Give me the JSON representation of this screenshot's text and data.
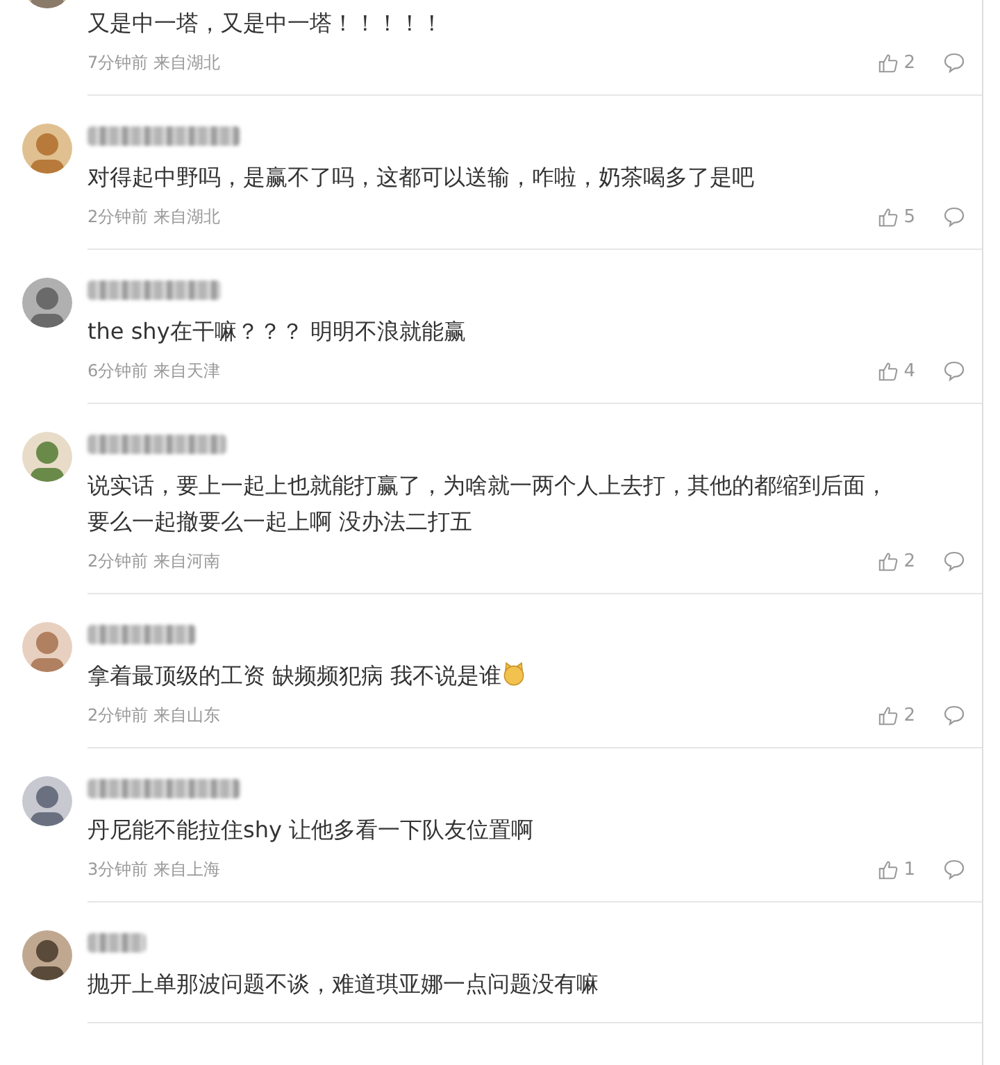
{
  "comments": [
    {
      "kind": "partial",
      "text": "又是中一塔，又是中一塔！！！！！",
      "emoji": false,
      "time": "7分钟前",
      "location": "来自湖北",
      "likes": "2"
    },
    {
      "kind": "full",
      "text": "对得起中野吗，是赢不了吗，这都可以送输，咋啦，奶茶喝多了是吧",
      "emoji": false,
      "time": "2分钟前",
      "location": "来自湖北",
      "likes": "5"
    },
    {
      "kind": "full",
      "text": "the shy在干嘛？？？ 明明不浪就能赢",
      "emoji": false,
      "time": "6分钟前",
      "location": "来自天津",
      "likes": "4"
    },
    {
      "kind": "full",
      "text": "说实话，要上一起上也就能打赢了，为啥就一两个人上去打，其他的都缩到后面，要么一起撤要么一起上啊 没办法二打五",
      "emoji": false,
      "time": "2分钟前",
      "location": "来自河南",
      "likes": "2"
    },
    {
      "kind": "full",
      "text": "拿着最顶级的工资 缺频频犯病 我不说是谁",
      "emoji": true,
      "time": "2分钟前",
      "location": "来自山东",
      "likes": "2"
    },
    {
      "kind": "full",
      "text": "丹尼能不能拉住shy 让他多看一下队友位置啊",
      "emoji": false,
      "time": "3分钟前",
      "location": "来自上海",
      "likes": "1"
    },
    {
      "kind": "full",
      "text": "抛开上单那波问题不谈，难道琪亚娜一点问题没有嘛",
      "emoji": false
    }
  ]
}
